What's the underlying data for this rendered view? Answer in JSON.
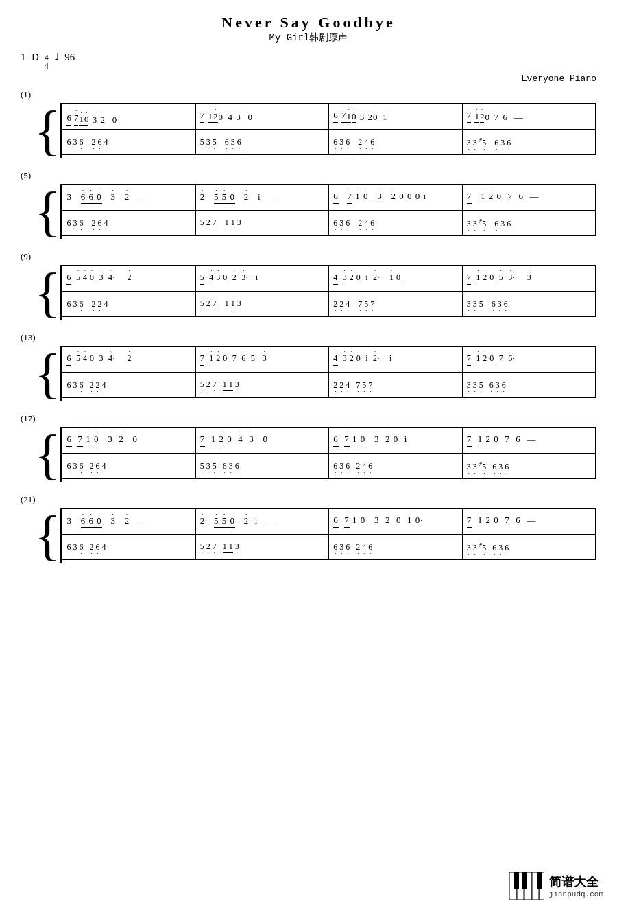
{
  "title": "Never Say Goodbye",
  "subtitle": "My Girl韩剧原声",
  "key_info": "1=D",
  "time_sig_top": "4",
  "time_sig_bottom": "4",
  "tempo": "♩=96",
  "watermark": "Everyone Piano",
  "sections": [
    {
      "num": "(1)",
      "top_bars": [
        "6̲ 7̲1̇0̇ 3̇ 2̇   0",
        "7̲ 1̇2̇0 4̇ 3̇   0",
        "6̲ 7̲1̇0̇ 3̇ 2̇0  1̇",
        "7̲ 1̇2̇0 7 6  —"
      ],
      "bottom_bars": [
        "6̲3̲6̲   2̲6̲4̲",
        "5̲3̲5̲   6̲3̲6̲",
        "6̲3̲6̲   2̲4̲6̲",
        "3̲3̲#5̲   6̲3̲6̲"
      ]
    }
  ],
  "logo": {
    "cn": "简谱大全",
    "pinyin": "jianpudq.com"
  }
}
